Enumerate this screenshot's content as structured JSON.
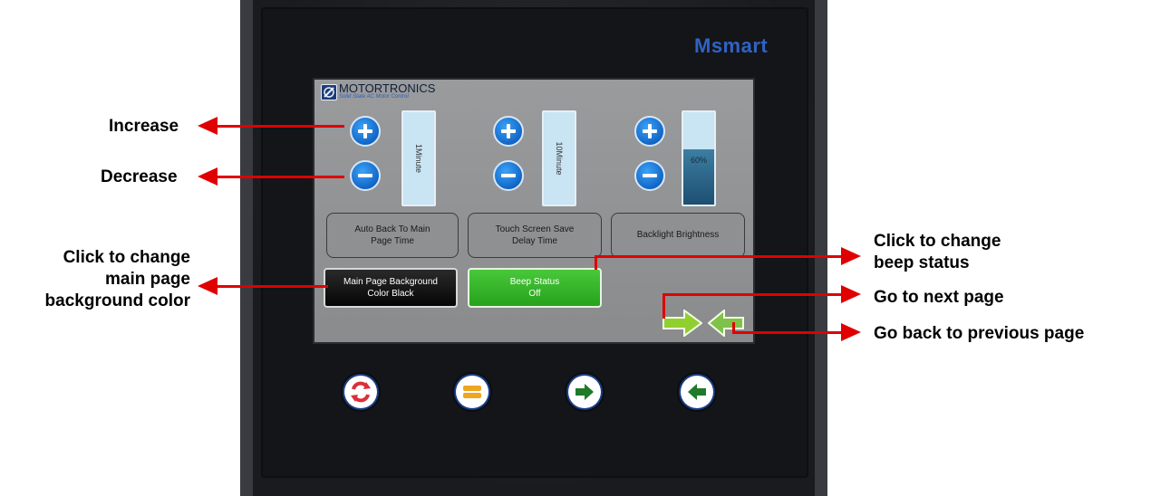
{
  "device": {
    "brand": "Msmart"
  },
  "screen": {
    "logo": {
      "name": "MOTORTRONICS",
      "tagline": "Solid State AC Motor Control"
    },
    "columns": [
      {
        "slot_label": "1Minute",
        "caption": "Auto Back To Main Page Time"
      },
      {
        "slot_label": "10Minute",
        "caption": "Touch Screen Save Delay Time"
      },
      {
        "slot_label": "60%",
        "caption": "Backlight Brightness",
        "level_fraction": 0.6
      }
    ],
    "buttons": {
      "background_color": "Main Page Background Color Black",
      "beep_status": "Beep Status Off"
    }
  },
  "annotations": {
    "increase": "Increase",
    "decrease": "Decrease",
    "change_bg_line1": "Click to change",
    "change_bg_line2": "main page",
    "change_bg_line3": "background color",
    "change_beep_line1": "Click to change",
    "change_beep_line2": "beep status",
    "next_page": "Go to next page",
    "prev_page": "Go back to previous page"
  },
  "colors": {
    "arrow": "#e00000",
    "brand": "#2f63c6",
    "beep_on": "#2ea823"
  },
  "icons": {
    "hw1": "refresh-icon",
    "hw2": "menu-icon",
    "hw3": "arrow-right-icon",
    "hw4": "arrow-left-icon"
  }
}
